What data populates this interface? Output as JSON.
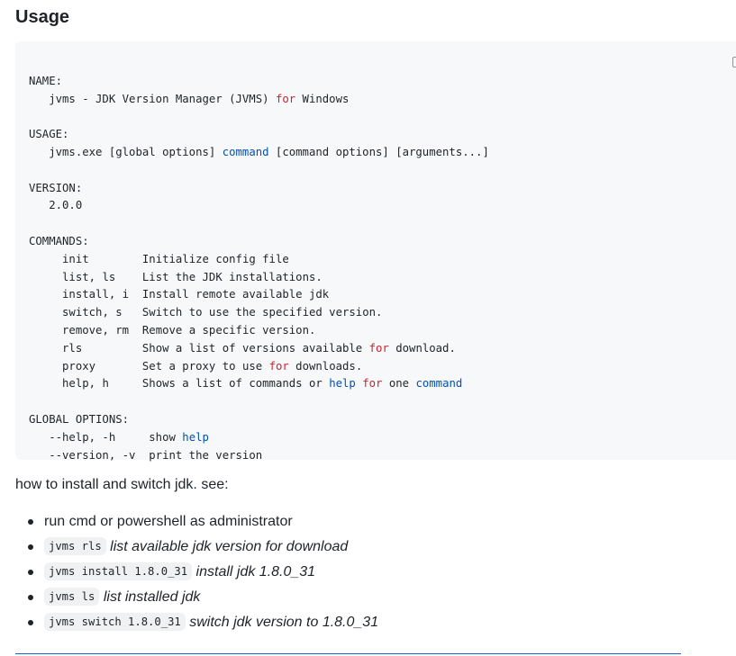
{
  "heading": "Usage",
  "code": {
    "name_header": "NAME:",
    "name_line": {
      "pre": "   jvms - JDK Version Manager (JVMS) ",
      "kw": "for",
      "post": " Windows"
    },
    "usage_header": "USAGE:",
    "usage_line": {
      "pre": "   jvms.exe [global options] ",
      "fn": "command",
      "post": " [command options] [arguments...]"
    },
    "version_header": "VERSION:",
    "version_value": "   2.0.0",
    "commands_header": "COMMANDS:",
    "commands": [
      {
        "name": "init",
        "desc": "Initialize config file"
      },
      {
        "name": "list, ls",
        "desc": "List the JDK installations."
      },
      {
        "name": "install, i",
        "desc": "Install remote available jdk"
      },
      {
        "name": "switch, s",
        "desc": "Switch to use the specified version."
      },
      {
        "name": "remove, rm",
        "desc": "Remove a specific version."
      }
    ],
    "cmd_rls": {
      "name": "rls",
      "pre": "Show a list of versions available ",
      "kw": "for",
      "post": " download."
    },
    "cmd_proxy": {
      "name": "proxy",
      "pre": "Set a proxy to use ",
      "kw": "for",
      "post": " downloads."
    },
    "cmd_help": {
      "name": "help, h",
      "pre": "Shows a list of commands or ",
      "fn1": "help",
      "sp1": " ",
      "kw": "for",
      "sp2": " one ",
      "fn2": "command"
    },
    "global_header": "GLOBAL OPTIONS:",
    "opt_help": {
      "name": "   --help, -h     ",
      "pre": "show ",
      "fn": "help"
    },
    "opt_version": {
      "name": "   --version, -v  ",
      "desc": "print the version"
    }
  },
  "paragraph": "how to install and switch jdk. see:",
  "list": [
    {
      "text": "run cmd or powershell as administrator"
    },
    {
      "code": "jvms rls",
      "desc": "list available jdk version for download"
    },
    {
      "code": "jvms install 1.8.0_31",
      "desc": "install jdk 1.8.0_31"
    },
    {
      "code": "jvms ls",
      "desc": "list installed jdk"
    },
    {
      "code": "jvms switch 1.8.0_31",
      "desc": "switch jdk version to 1.8.0_31"
    }
  ]
}
